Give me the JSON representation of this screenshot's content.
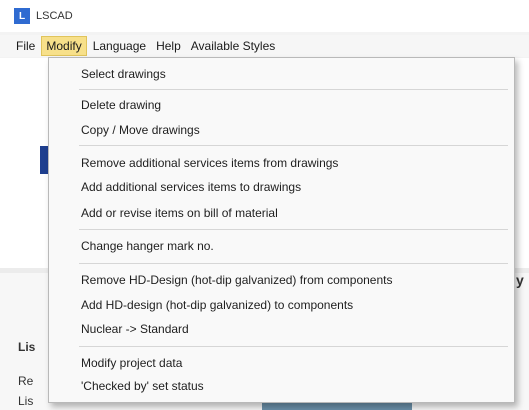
{
  "window": {
    "title": "LSCAD",
    "icon_label": "L"
  },
  "menubar": {
    "items": [
      "File",
      "Modify",
      "Language",
      "Help",
      "Available Styles"
    ],
    "active_index": 1
  },
  "background": {
    "label_1": "Lis",
    "label_2": "Re",
    "label_3": "Lis",
    "right_char": "y"
  },
  "modify_menu": {
    "groups": [
      [
        "Select drawings"
      ],
      [
        "Delete drawing",
        "Copy / Move drawings"
      ],
      [
        "Remove additional services items from drawings",
        "Add additional services items to drawings",
        "Add or revise items on bill of material"
      ],
      [
        "Change hanger mark no."
      ],
      [
        "Remove HD-Design (hot-dip galvanized) from components",
        "Add HD-design (hot-dip galvanized) to components",
        "Nuclear -> Standard"
      ],
      [
        "Modify project data",
        "'Checked by' set status"
      ]
    ]
  }
}
